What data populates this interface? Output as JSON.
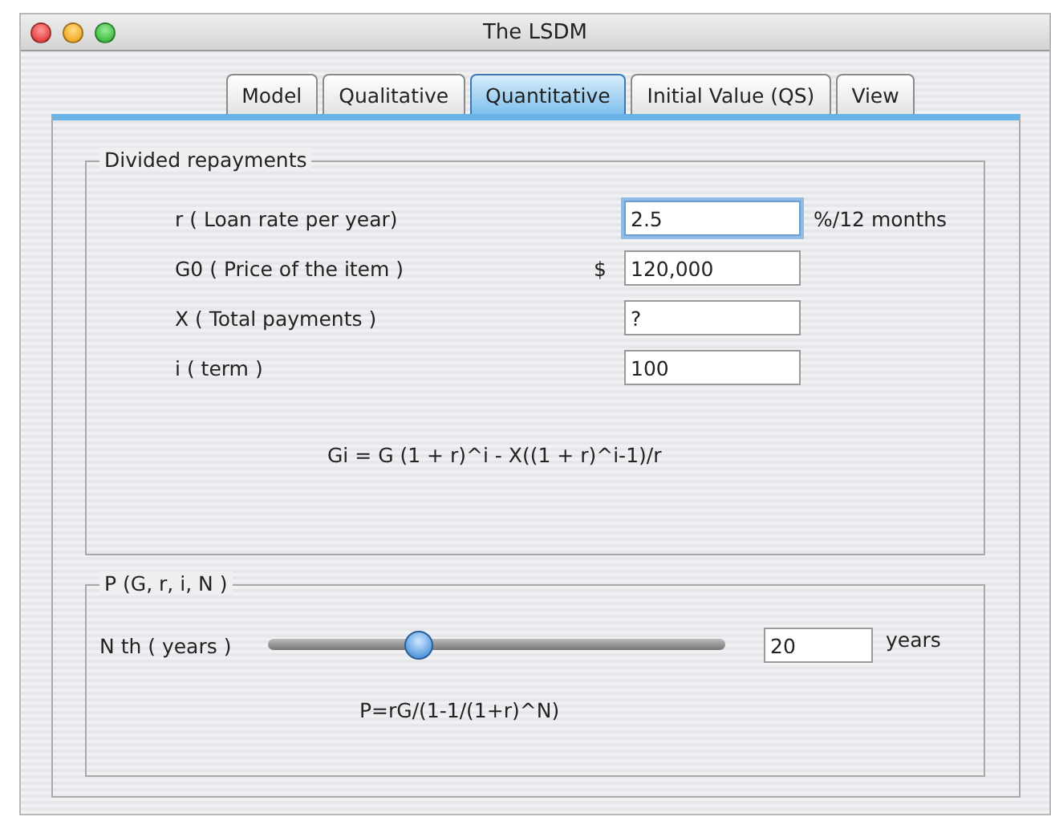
{
  "window": {
    "title": "The LSDM"
  },
  "tabs": [
    {
      "label": "Model",
      "selected": false
    },
    {
      "label": "Qualitative",
      "selected": false
    },
    {
      "label": "Quantitative",
      "selected": true
    },
    {
      "label": "Initial Value (QS)",
      "selected": false
    },
    {
      "label": "View",
      "selected": false
    }
  ],
  "divided_repayments": {
    "title": "Divided repayments",
    "fields": [
      {
        "label": "r  ( Loan rate per year)",
        "value": "2.5",
        "suffix": "%/12 months",
        "focused": true
      },
      {
        "label": "G0 ( Price of the item )",
        "prefix": "$",
        "value": "120,000",
        "focused": false
      },
      {
        "label": "X ( Total payments )",
        "value": "?",
        "focused": false
      },
      {
        "label": "i ( term )",
        "value": "100",
        "focused": false
      }
    ],
    "formula": "Gi = G (1 + r)^i - X((1 + r)^i-1)/r"
  },
  "payment": {
    "title": "P (G, r, i, N )",
    "slider_label": "N th ( years )",
    "level": 0.32,
    "value": "20",
    "unit": "years",
    "formula": "P=rG/(1-1/(1+r)^N)"
  }
}
